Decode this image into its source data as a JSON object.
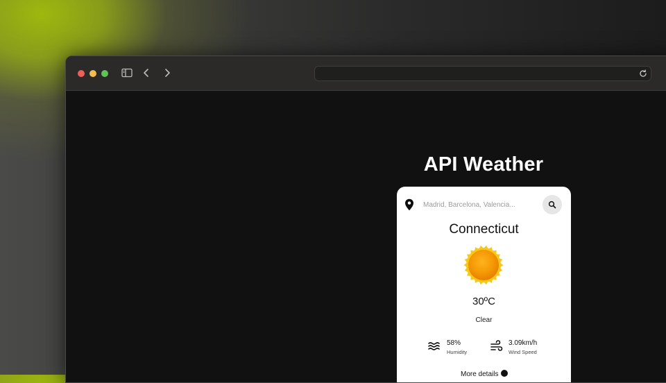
{
  "browser": {
    "url": "",
    "icons": [
      "close-dot",
      "minimize-dot",
      "zoom-dot",
      "sidebar-icon",
      "chevron-left-icon",
      "chevron-right-icon",
      "reload-icon"
    ]
  },
  "app": {
    "title": "API Weather",
    "search": {
      "placeholder": "Madrid, Barcelona, Valencia...",
      "value": ""
    },
    "location": "Connecticut",
    "weather_icon": "sun-icon",
    "temperature": "30ºC",
    "description": "Clear",
    "humidity": {
      "value": "58%",
      "label": "Humidity"
    },
    "wind": {
      "value": "3.09km/h",
      "label": "Wind Speed"
    },
    "more_details": "More details"
  },
  "colors": {
    "accent_glow": "#9fb80e",
    "page_bg": "#111111",
    "card_bg": "#ffffff",
    "sun_outer": "#f5c518",
    "sun_inner": "#f08a00"
  }
}
